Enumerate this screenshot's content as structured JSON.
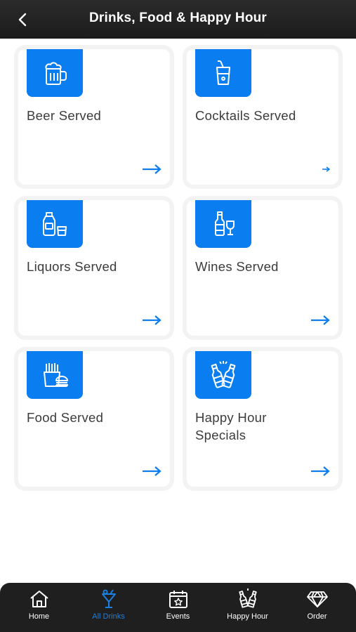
{
  "header": {
    "title": "Drinks, Food & Happy Hour",
    "back_icon": "chevron-left-icon"
  },
  "colors": {
    "accent": "#0A7EF0",
    "header_bg": "#1C1C1C",
    "tab_active": "#1A7FE0"
  },
  "cards": [
    {
      "label": "Beer Served",
      "icon": "beer-mug-icon"
    },
    {
      "label": "Cocktails Served",
      "icon": "cocktail-glass-icon"
    },
    {
      "label": "Liquors Served",
      "icon": "liquor-bottle-icon"
    },
    {
      "label": "Wines Served",
      "icon": "wine-bottle-icon"
    },
    {
      "label": "Food Served",
      "icon": "fries-burger-icon"
    },
    {
      "label": "Happy Hour\nSpecials",
      "icon": "cheers-bottles-icon"
    }
  ],
  "tabbar": {
    "items": [
      {
        "label": "Home",
        "icon": "home-icon",
        "active": false
      },
      {
        "label": "All Drinks",
        "icon": "drink-glass-icon",
        "active": true
      },
      {
        "label": "Events",
        "icon": "calendar-star-icon",
        "active": false
      },
      {
        "label": "Happy Hour",
        "icon": "cheers-bottles-icon",
        "active": false
      },
      {
        "label": "Order",
        "icon": "diamond-icon",
        "active": false
      }
    ]
  }
}
